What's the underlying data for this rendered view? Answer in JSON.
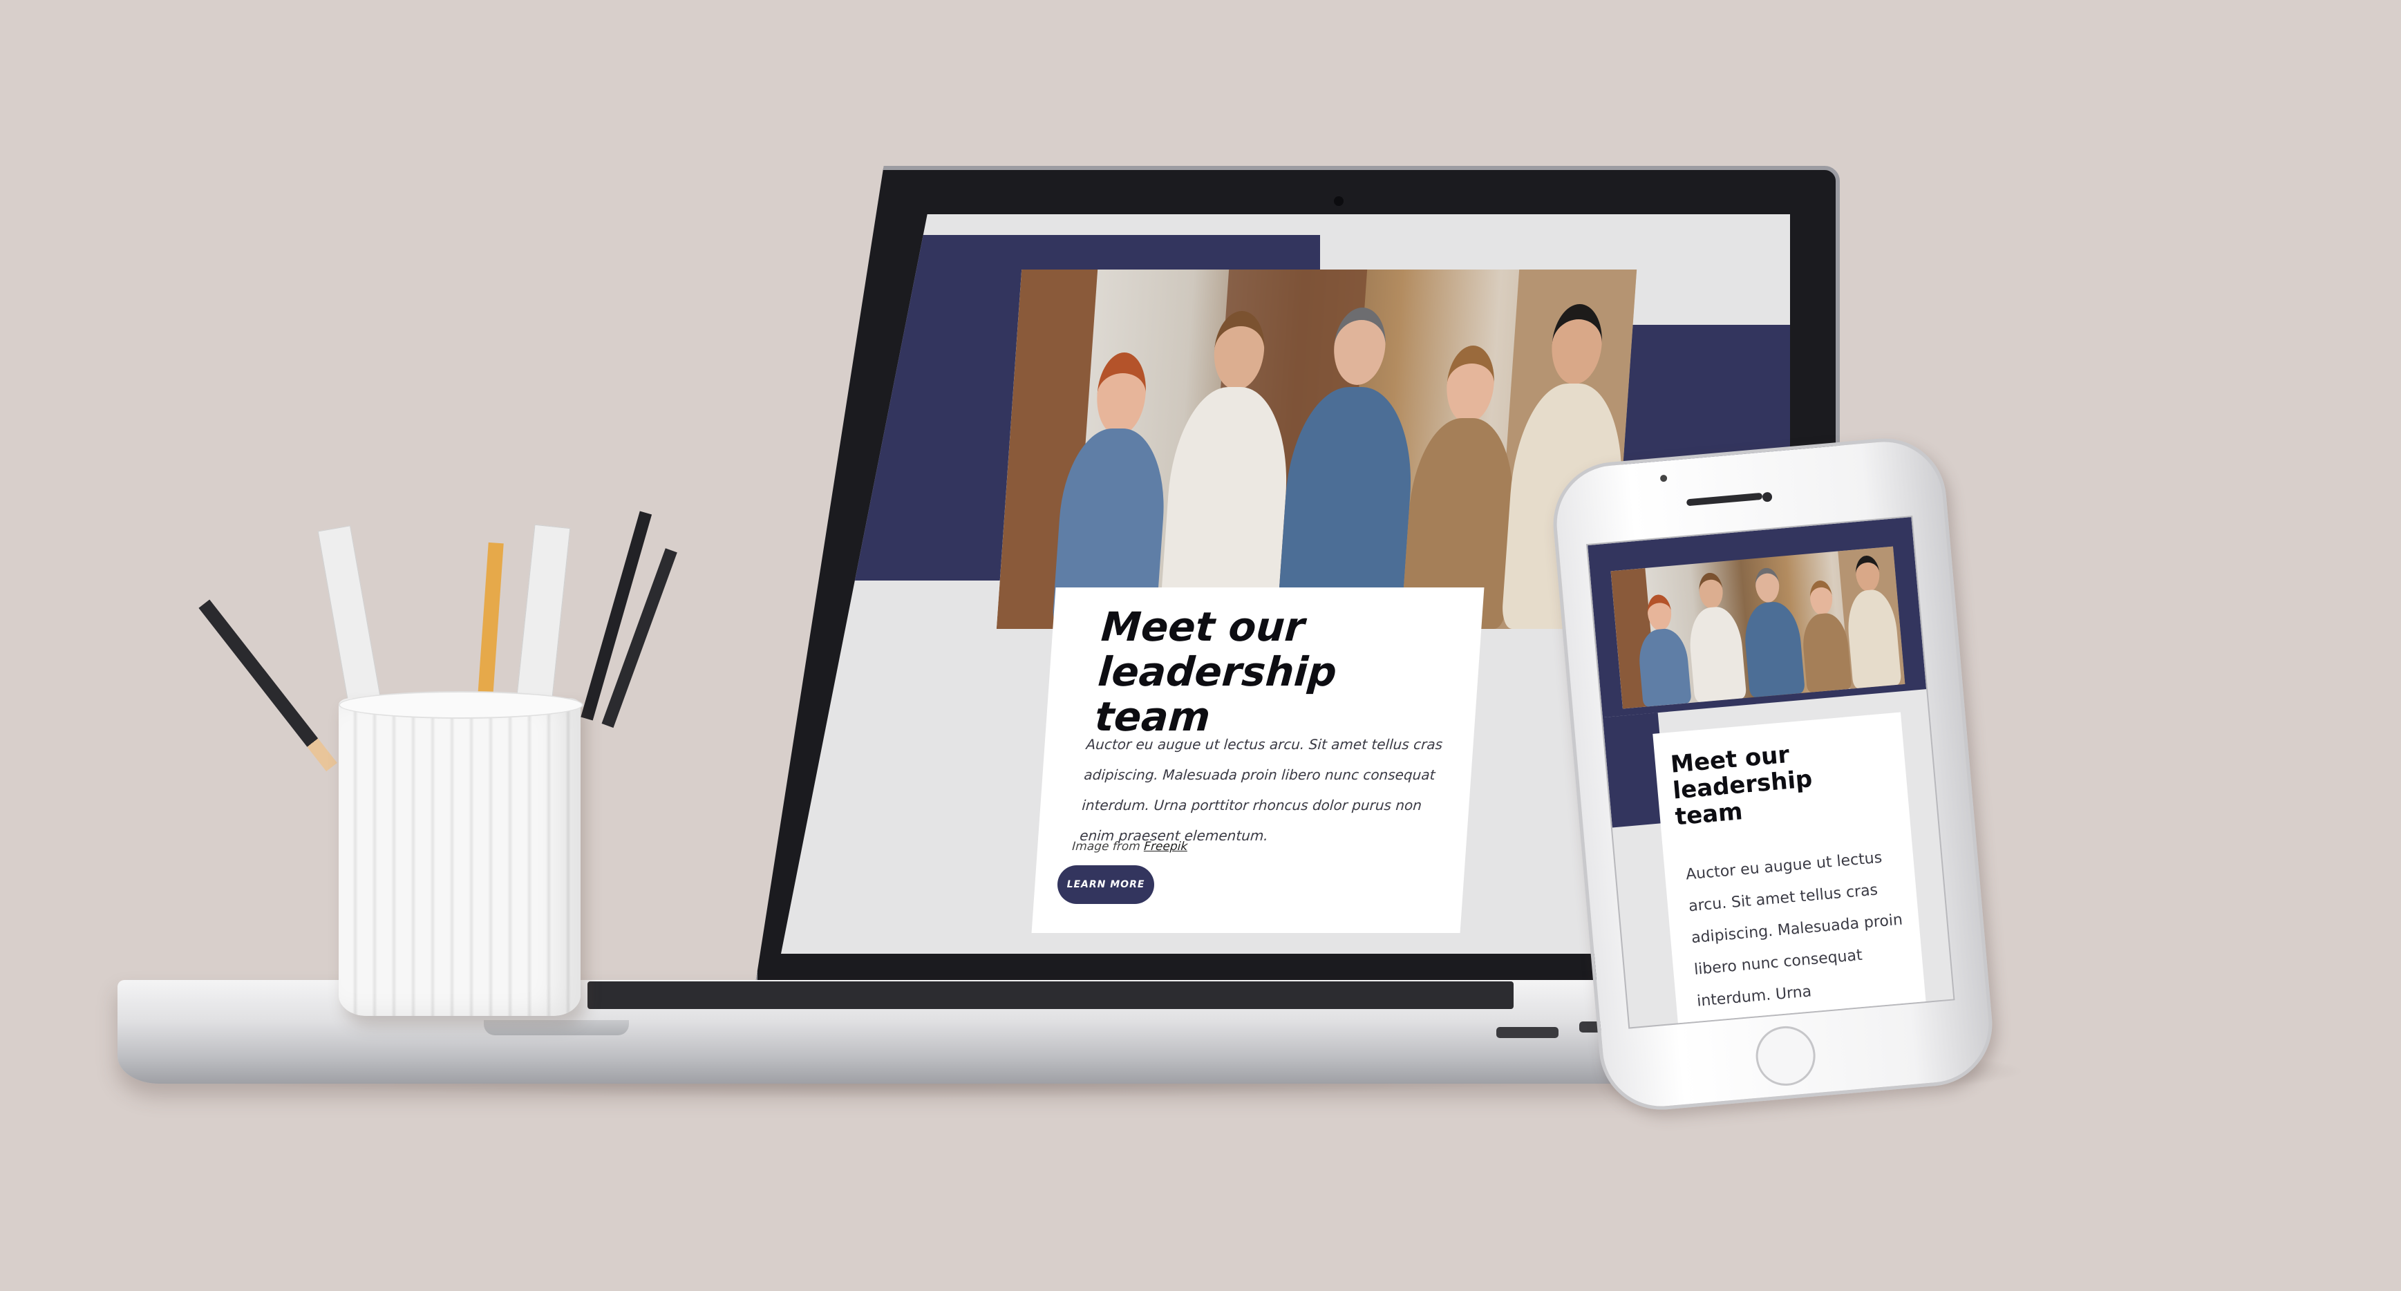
{
  "laptop_site": {
    "heading": "Meet our leadership team",
    "body": "Auctor eu augue ut lectus arcu. Sit amet tellus cras adipiscing. Malesuada proin libero nunc consequat interdum. Urna porttitor rhoncus dolor purus non enim praesent elementum.",
    "credit_prefix": "Image from",
    "credit_link": "Freepik",
    "button_label": "LEARN MORE"
  },
  "phone_site": {
    "heading": "Meet our leadership team",
    "body": "Auctor eu augue ut lectus arcu. Sit amet tellus cras adipiscing. Malesuada proin libero nunc consequat interdum. Urna"
  },
  "colors": {
    "navy_accent": "#33355e",
    "background": "#d8cfcb",
    "screen_gray": "#e4e4e5"
  },
  "icons": [
    "camera-icon",
    "home-button-icon",
    "speaker-icon"
  ]
}
